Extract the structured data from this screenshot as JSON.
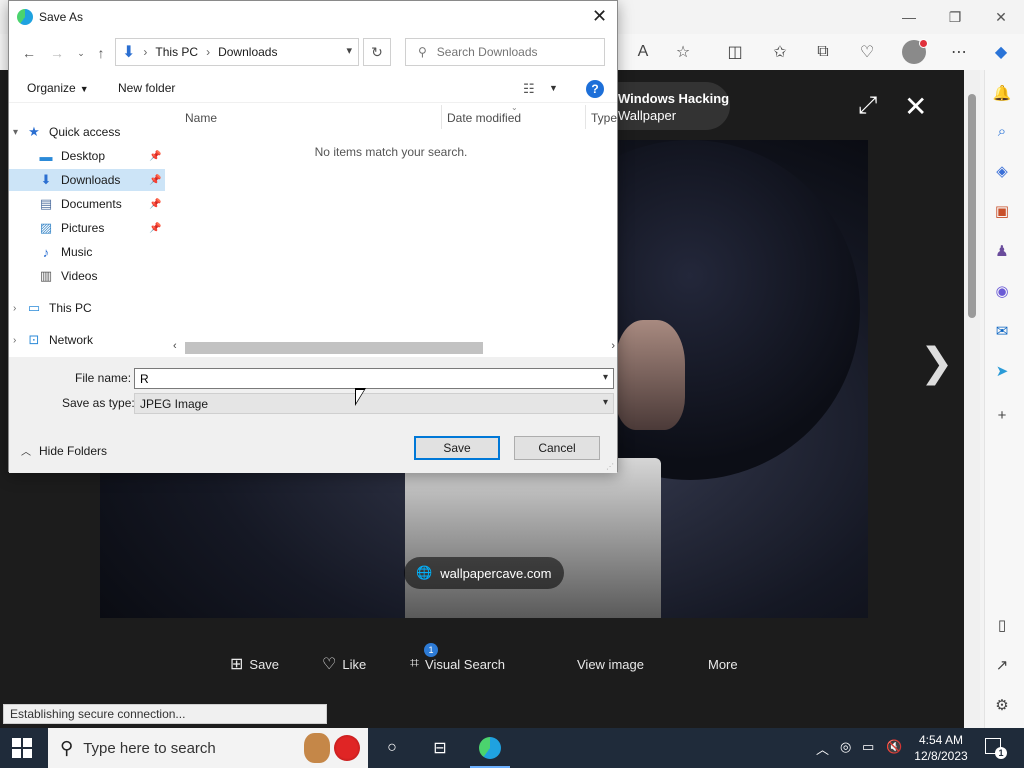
{
  "browser": {
    "window_controls": {
      "minimize": "—",
      "restore": "❐",
      "close": "✕"
    },
    "status_text": "Establishing secure connection...",
    "viewer": {
      "title_line1": "Windows Hacking",
      "title_line2": "Wallpaper",
      "watermark": "wallpapercave.com",
      "actions": [
        {
          "label": "Save"
        },
        {
          "label": "Like"
        },
        {
          "label": "Visual Search",
          "badge": "1"
        },
        {
          "label": "View image"
        },
        {
          "label": "More"
        }
      ]
    }
  },
  "dialog": {
    "title": "Save As",
    "address": {
      "root": "This PC",
      "folder": "Downloads"
    },
    "search_placeholder": "Search Downloads",
    "commands": {
      "organize": "Organize",
      "new_folder": "New folder"
    },
    "nav": [
      {
        "label": "Quick access",
        "icon": "star-icon"
      },
      {
        "label": "Desktop",
        "icon": "desktop-icon",
        "pinned": true
      },
      {
        "label": "Downloads",
        "icon": "download-icon",
        "pinned": true,
        "selected": true
      },
      {
        "label": "Documents",
        "icon": "documents-icon",
        "pinned": true
      },
      {
        "label": "Pictures",
        "icon": "pictures-icon",
        "pinned": true
      },
      {
        "label": "Music",
        "icon": "music-icon"
      },
      {
        "label": "Videos",
        "icon": "videos-icon"
      },
      {
        "label": "This PC",
        "icon": "computer-icon"
      },
      {
        "label": "Network",
        "icon": "network-icon"
      }
    ],
    "columns": [
      "Name",
      "Date modified",
      "Type"
    ],
    "empty_message": "No items match your search.",
    "file_name_label": "File name:",
    "file_name_value": "R",
    "save_type_label": "Save as type:",
    "save_type_value": "JPEG Image",
    "hide_folders": "Hide Folders",
    "save_button": "Save",
    "cancel_button": "Cancel"
  },
  "taskbar": {
    "search_placeholder": "Type here to search",
    "time": "4:54 AM",
    "date": "12/8/2023",
    "notification_count": "1"
  },
  "colors": {
    "accent": "#0078d7",
    "selection": "#cce4f7",
    "taskbar": "#1f2b3a",
    "viewer_bg": "#1c1c1c"
  }
}
